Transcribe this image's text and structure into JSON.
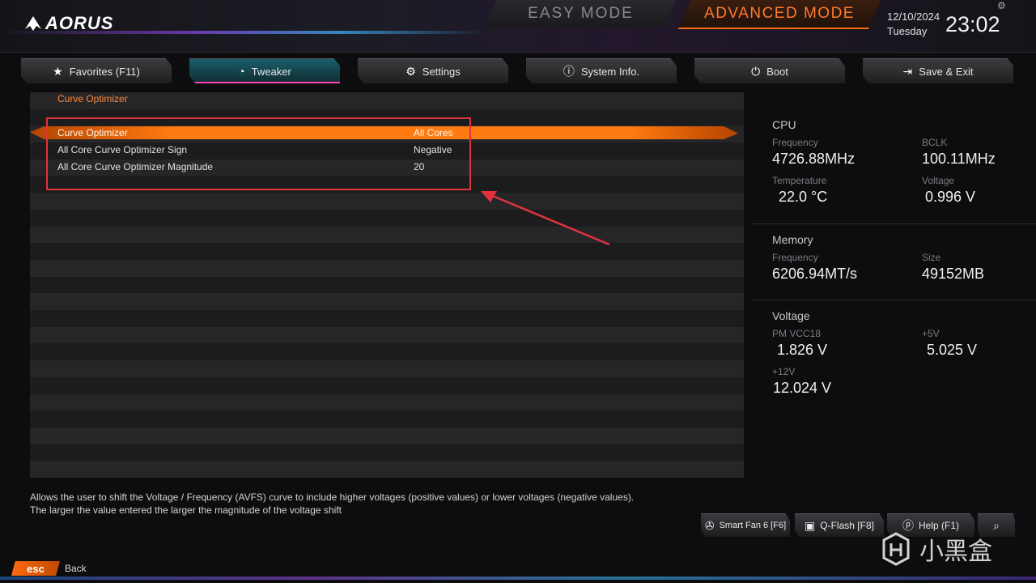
{
  "header": {
    "brand": "AORUS",
    "easy_mode": "EASY MODE",
    "advanced_mode": "ADVANCED MODE",
    "date": "12/10/2024",
    "day": "Tuesday",
    "time": "23:02"
  },
  "tabs": [
    {
      "label": "Favorites (F11)",
      "icon": "star-folder-icon",
      "active": false
    },
    {
      "label": "Tweaker",
      "icon": "speedometer-icon",
      "active": true
    },
    {
      "label": "Settings",
      "icon": "gear-icon",
      "active": false
    },
    {
      "label": "System Info.",
      "icon": "info-icon",
      "active": false
    },
    {
      "label": "Boot",
      "icon": "power-icon",
      "active": false
    },
    {
      "label": "Save & Exit",
      "icon": "exit-icon",
      "active": false
    }
  ],
  "main": {
    "section_title": "Curve Optimizer",
    "items": [
      {
        "label": "Curve Optimizer",
        "value": "All Cores",
        "selected": true
      },
      {
        "label": "All Core Curve Optimizer Sign",
        "value": "Negative",
        "selected": false
      },
      {
        "label": "All Core Curve Optimizer Magnitude",
        "value": "20",
        "selected": false
      }
    ]
  },
  "info": {
    "cpu": {
      "title": "CPU",
      "frequency_label": "Frequency",
      "frequency": "4726.88MHz",
      "bclk_label": "BCLK",
      "bclk": "100.11MHz",
      "temperature_label": "Temperature",
      "temperature": "22.0 °C",
      "voltage_label": "Voltage",
      "voltage": "0.996 V"
    },
    "memory": {
      "title": "Memory",
      "frequency_label": "Frequency",
      "frequency": "6206.94MT/s",
      "size_label": "Size",
      "size": "49152MB"
    },
    "voltage": {
      "title": "Voltage",
      "pm_vcc18_label": "PM VCC18",
      "pm_vcc18": "1.826 V",
      "p5v_label": "+5V",
      "p5v": "5.025 V",
      "p12v_label": "+12V",
      "p12v": "12.024 V"
    }
  },
  "description": {
    "line1": "Allows the user to shift the Voltage / Frequency (AVFS) curve to include higher voltages (positive values) or lower voltages (negative values).",
    "line2": "The larger the value entered the larger the magnitude of the voltage shift"
  },
  "footer": {
    "smart_fan": "Smart Fan 6 [F6]",
    "qflash": "Q-Flash [F8]",
    "help": "Help (F1)",
    "esc": "esc",
    "back": "Back"
  },
  "watermark": {
    "text": "小黑盒"
  },
  "colors": {
    "accent": "#ff7a10",
    "annotation": "#e0343c",
    "active_tab": "#1a5e6a"
  }
}
